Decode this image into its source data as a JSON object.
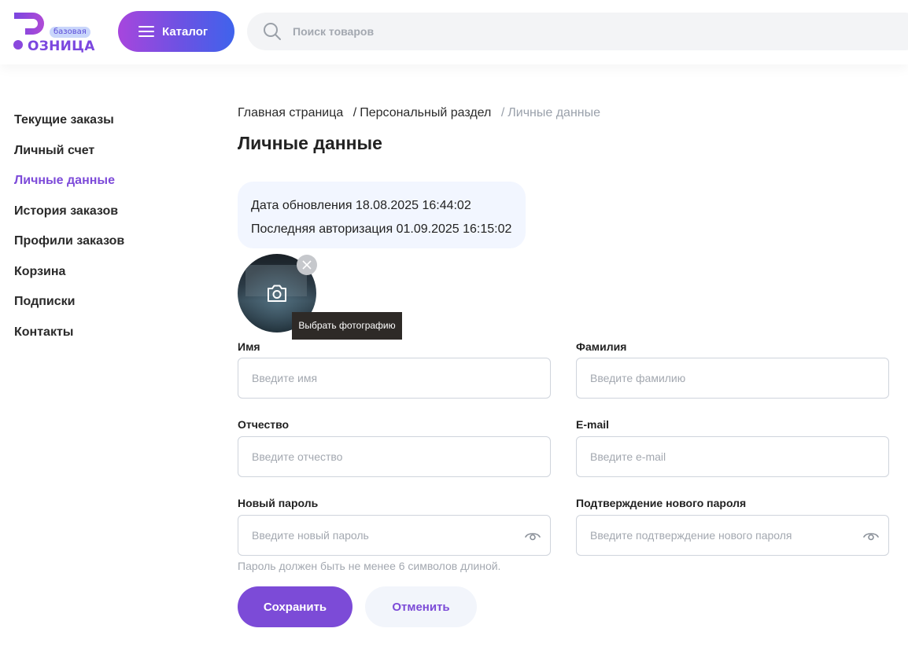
{
  "header": {
    "logo": {
      "badge": "базовая",
      "text": "ОЗНИЦА"
    },
    "catalog_label": "Каталог",
    "search": {
      "placeholder": "Поиск товаров"
    }
  },
  "sidebar": {
    "items": [
      {
        "label": "Текущие заказы"
      },
      {
        "label": "Личный счет"
      },
      {
        "label": "Личные данные",
        "active": true
      },
      {
        "label": "История заказов"
      },
      {
        "label": "Профили заказов"
      },
      {
        "label": "Корзина"
      },
      {
        "label": "Подписки"
      },
      {
        "label": "Контакты"
      }
    ]
  },
  "breadcrumb": {
    "home": "Главная страница",
    "section": "Персональный раздел",
    "current": "Личные данные",
    "separator": "/"
  },
  "page_title": "Личные данные",
  "info": {
    "updated": "Дата обновления 18.08.2025 16:44:02",
    "last_login": "Последняя авторизация 01.09.2025 16:15:02"
  },
  "avatar": {
    "tooltip": "Выбрать фотографию",
    "icons": {
      "camera": "camera-icon",
      "remove": "close-icon"
    }
  },
  "form": {
    "first_name": {
      "label": "Имя",
      "placeholder": "Введите имя",
      "value": ""
    },
    "last_name": {
      "label": "Фамилия",
      "placeholder": "Введите фамилию",
      "value": ""
    },
    "middle_name": {
      "label": "Отчество",
      "placeholder": "Введите отчество",
      "value": ""
    },
    "email": {
      "label": "E-mail",
      "placeholder": "Введите e-mail",
      "value": ""
    },
    "new_password": {
      "label": "Новый пароль",
      "placeholder": "Введите новый пароль",
      "value": ""
    },
    "confirm_password": {
      "label": "Подтверждение нового пароля",
      "placeholder": "Введите подтверждение нового пароля",
      "value": ""
    },
    "password_hint": "Пароль должен быть не менее 6 символов длиной."
  },
  "actions": {
    "save": "Сохранить",
    "cancel": "Отменить"
  },
  "colors": {
    "accent": "#7c4bd7",
    "catalog_gradient_start": "#a746dd",
    "catalog_gradient_end": "#3f63ec",
    "info_card_bg": "#f2f6ff",
    "tooltip_bg": "#2e2a27"
  }
}
